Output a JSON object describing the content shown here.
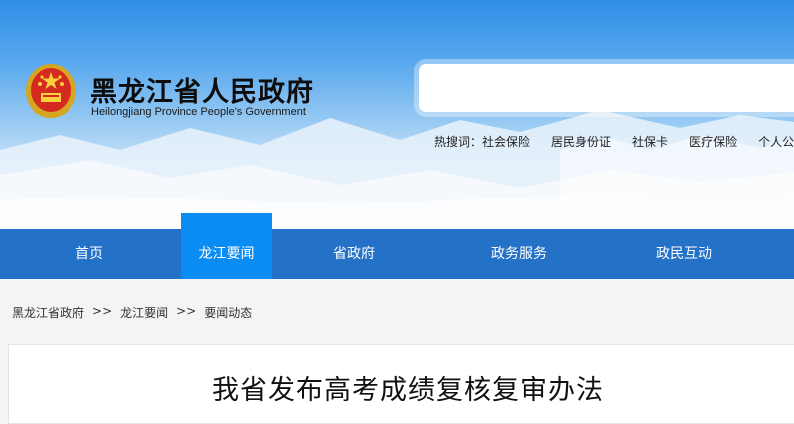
{
  "site": {
    "title": "黑龙江省人民政府",
    "subtitle": "Heilongjiang Province People's Government"
  },
  "search": {
    "placeholder": ""
  },
  "hot_search": {
    "label": "热搜词：",
    "items": [
      "社会保险",
      "居民身份证",
      "社保卡",
      "医疗保险",
      "个人公"
    ]
  },
  "nav": {
    "items": [
      {
        "label": "首页",
        "active": false
      },
      {
        "label": "龙江要闻",
        "active": true
      },
      {
        "label": "省政府",
        "active": false
      },
      {
        "label": "政务服务",
        "active": false
      },
      {
        "label": "政民互动",
        "active": false
      }
    ]
  },
  "breadcrumb": {
    "items": [
      "黑龙江省政府",
      "龙江要闻",
      "要闻动态"
    ],
    "separator": ">>"
  },
  "article": {
    "title": "我省发布高考成绩复核复审办法"
  },
  "colors": {
    "nav_bg": "#2471c8",
    "nav_active": "#0a8cf2",
    "accent": "#2f8ee6"
  }
}
